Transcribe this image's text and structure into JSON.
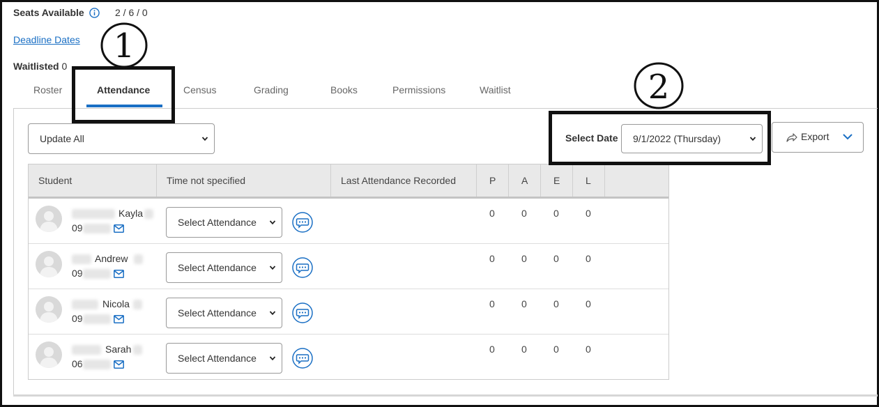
{
  "header": {
    "seats_label": "Seats Available",
    "seats_value": "2 / 6 / 0",
    "deadline_link": "Deadline Dates",
    "waitlisted_label": "Waitlisted",
    "waitlisted_value": "0"
  },
  "tabs": [
    {
      "label": "Roster"
    },
    {
      "label": "Attendance",
      "active": true
    },
    {
      "label": "Census"
    },
    {
      "label": "Grading"
    },
    {
      "label": "Books"
    },
    {
      "label": "Permissions"
    },
    {
      "label": "Waitlist"
    }
  ],
  "toolbar": {
    "update_all": "Update All",
    "select_date_label": "Select Date",
    "select_date_value": "9/1/2022 (Thursday)",
    "export_label": "Export"
  },
  "annotations": {
    "one": "1",
    "two": "2"
  },
  "table": {
    "headers": [
      "Student",
      "Time not specified",
      "Last Attendance Recorded",
      "P",
      "A",
      "E",
      "L"
    ],
    "rows": [
      {
        "first_name": "Kayla",
        "id_prefix": "09",
        "attendance": "Select Attendance",
        "P": "0",
        "A": "0",
        "E": "0",
        "L": "0"
      },
      {
        "first_name": "Andrew",
        "id_prefix": "09",
        "attendance": "Select Attendance",
        "P": "0",
        "A": "0",
        "E": "0",
        "L": "0"
      },
      {
        "first_name": "Nicola",
        "id_prefix": "09",
        "attendance": "Select Attendance",
        "P": "0",
        "A": "0",
        "E": "0",
        "L": "0"
      },
      {
        "first_name": "Sarah",
        "id_prefix": "06",
        "attendance": "Select Attendance",
        "P": "0",
        "A": "0",
        "E": "0",
        "L": "0"
      }
    ]
  },
  "colors": {
    "accent": "#1a6fc4",
    "annotation": "#111111"
  },
  "icons": [
    "info-icon",
    "mail-icon",
    "comment-icon",
    "share-icon",
    "chevron-down-icon",
    "avatar-placeholder-icon"
  ]
}
